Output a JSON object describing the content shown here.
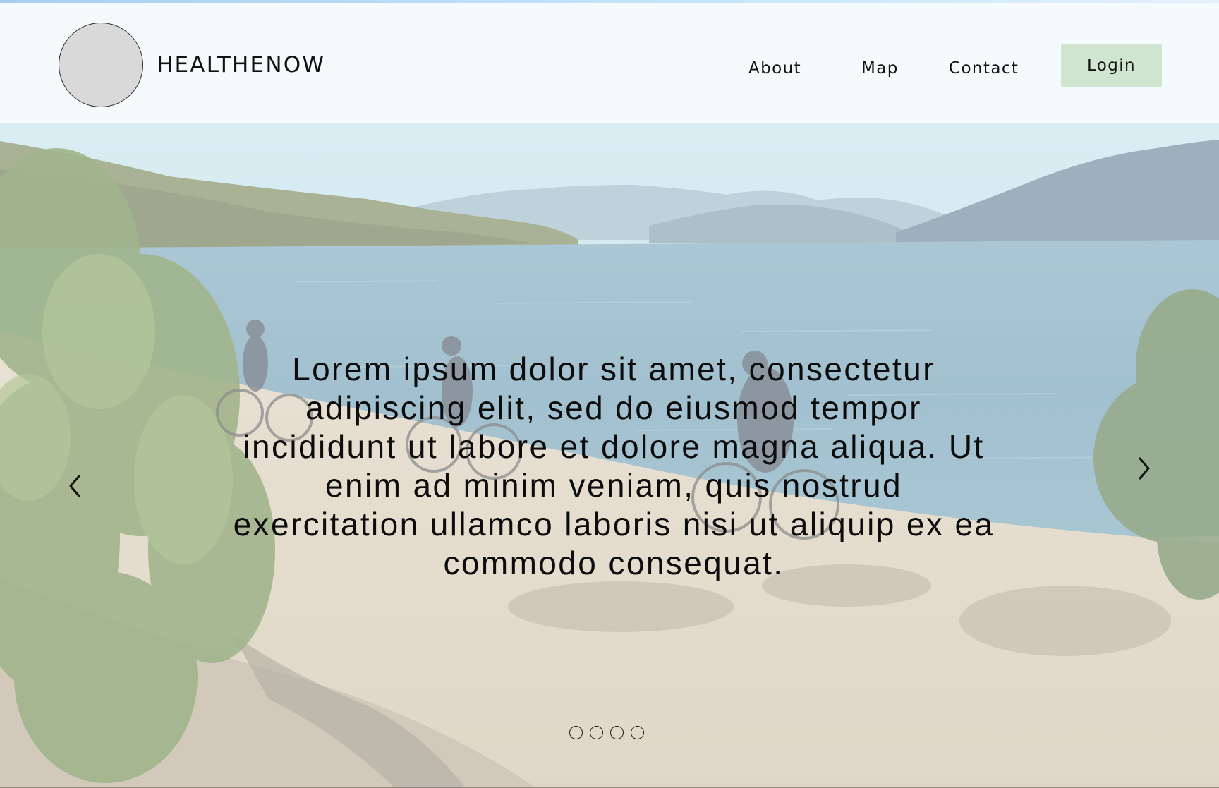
{
  "header": {
    "brand": "HEALTHENOW",
    "nav": {
      "about": "About",
      "map": "Map",
      "contact": "Contact"
    },
    "login_label": "Login"
  },
  "hero": {
    "text": "Lorem ipsum dolor sit amet, consectetur adipiscing elit, sed do eiusmod tempor incididunt ut labore et dolore magna aliqua. Ut enim ad minim veniam, quis nostrud exercitation ullamco laboris nisi ut aliquip ex ea commodo consequat.",
    "image": "lakeside-cycling-photo"
  },
  "carousel": {
    "slide_count": 4,
    "prev_icon": "chevron-left-icon",
    "next_icon": "chevron-right-icon"
  },
  "colors": {
    "login_bg": "#cfe5cf",
    "header_bg": "#f7fcfd",
    "text": "#111111"
  }
}
